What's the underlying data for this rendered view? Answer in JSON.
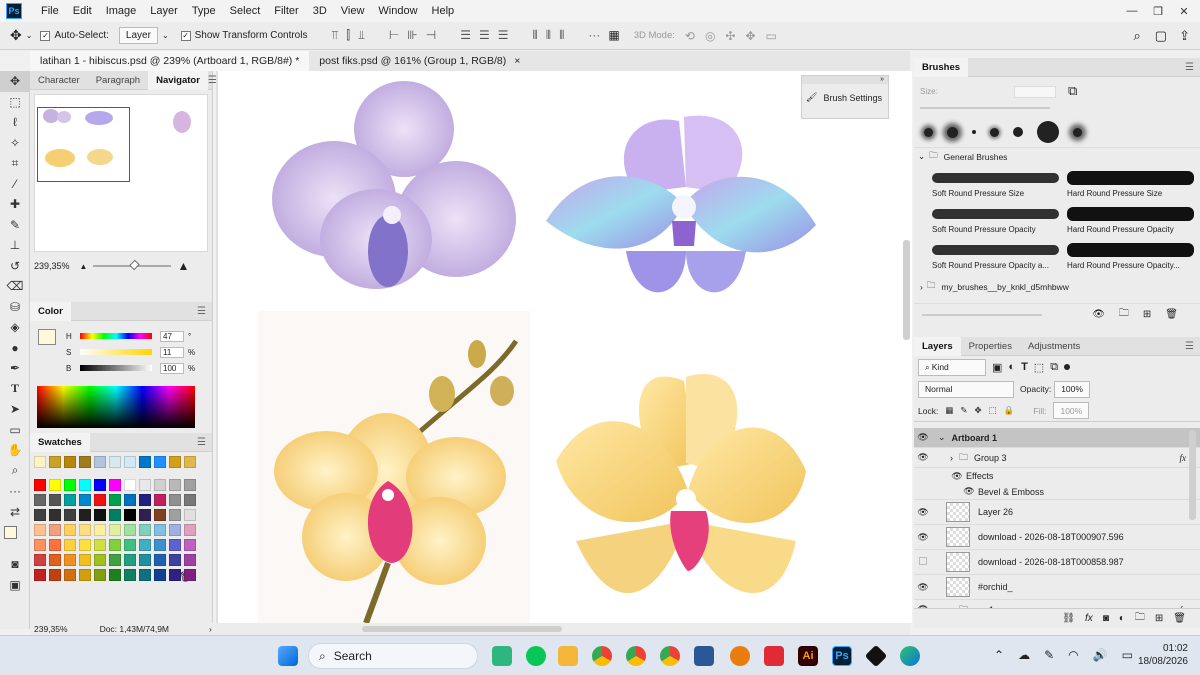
{
  "app": {
    "logo": "Ps"
  },
  "menu": [
    "File",
    "Edit",
    "Image",
    "Layer",
    "Type",
    "Select",
    "Filter",
    "3D",
    "View",
    "Window",
    "Help"
  ],
  "options": {
    "auto_select_label": "Auto-Select:",
    "auto_select_value": "Layer",
    "transform_label": "Show Transform Controls",
    "mode3d_label": "3D Mode:"
  },
  "tabs": [
    {
      "label": "latihan 1 - hibiscus.psd @ 239% (Artboard 1, RGB/8#) *",
      "close": "×"
    },
    {
      "label": "post fiks.psd @ 161% (Group 1, RGB/8)",
      "close": "×"
    }
  ],
  "left_panel": {
    "tabs": [
      "Character",
      "Paragraph",
      "Navigator"
    ],
    "nav_zoom": "239,35%",
    "color_tab": "Color",
    "hsb": [
      {
        "label": "H",
        "value": "47",
        "unit": "°"
      },
      {
        "label": "S",
        "value": "11",
        "unit": "%"
      },
      {
        "label": "B",
        "value": "100",
        "unit": "%"
      }
    ],
    "swatches_tab": "Swatches"
  },
  "canvas": {
    "brush_settings": "Brush Settings"
  },
  "brushes": {
    "title": "Brushes",
    "size_label": "Size:",
    "group_general": "General Brushes",
    "items": [
      "Soft Round Pressure Size",
      "Hard Round Pressure Size",
      "Soft Round Pressure Opacity",
      "Hard Round Pressure Opacity",
      "Soft Round Pressure Opacity a...",
      "Hard Round Pressure Opacity..."
    ],
    "group_custom": "my_brushes__by_knkl_d5mhbww"
  },
  "layers_panel": {
    "tabs": [
      "Layers",
      "Properties",
      "Adjustments"
    ],
    "kind": "Kind",
    "blend": "Normal",
    "opacity_label": "Opacity:",
    "opacity_value": "100%",
    "lock_label": "Lock:",
    "fill_label": "Fill:",
    "fill_value": "100%",
    "layers": [
      {
        "name": "Artboard 1",
        "visible": true,
        "kind": "artboard"
      },
      {
        "name": "Group 3",
        "visible": true,
        "kind": "group",
        "fx": "fx"
      },
      {
        "name": "Effects",
        "visible": true,
        "kind": "effects"
      },
      {
        "name": "Bevel & Emboss",
        "visible": true,
        "kind": "effect"
      },
      {
        "name": "Layer 26",
        "visible": true,
        "kind": "layer"
      },
      {
        "name": "download - 2026-08-18T000907.596",
        "visible": true,
        "kind": "smart"
      },
      {
        "name": "download - 2026-08-18T000858.987",
        "visible": false,
        "kind": "smart"
      },
      {
        "name": "#orchid_",
        "visible": true,
        "kind": "smart"
      },
      {
        "name": "orc 1",
        "visible": true,
        "kind": "group",
        "fx": "fx"
      }
    ]
  },
  "status": {
    "zoom": "239,35%",
    "doc": "Doc: 1,43M/74,9M"
  },
  "taskbar": {
    "search": "Search",
    "time": "01:02",
    "date": "18/08/2026"
  },
  "colors": {
    "accent": "#31a8ff",
    "fg_swatch": "#fff8dc",
    "nav_frame": "#e02020"
  },
  "swatch_colors": [
    "#fff3c4",
    "#c9a227",
    "#b8860b",
    "#9e7d1a",
    "#b0c4de",
    "#d8e8f0",
    "#d0e8f8",
    "#0077cc",
    "#1e90ff",
    "#d4a017",
    "#e0b84a",
    "#ff0000",
    "#ffff00",
    "#00ff00",
    "#00ffff",
    "#0000ff",
    "#ff00ff",
    "#ffffff",
    "#e8e8e8",
    "#d0d0d0",
    "#b8b8b8",
    "#a0a0a0",
    "#666666",
    "#555555",
    "#00a0a0",
    "#0088cc",
    "#ee1111",
    "#00a050",
    "#0070c0",
    "#202080",
    "#c02060",
    "#909090",
    "#787878",
    "#404040",
    "#303030",
    "#404040",
    "#202020",
    "#101010",
    "#008060",
    "#000000",
    "#302050",
    "#804020",
    "#a0a0a0",
    "#e0e0e0",
    "#ffc090",
    "#f0a080",
    "#ffd060",
    "#ffe080",
    "#fff0a0",
    "#e0f0a0",
    "#a0e0a0",
    "#80d0c0",
    "#80c0e0",
    "#a0b0e0",
    "#e0a0c0",
    "#ff9060",
    "#ff7040",
    "#ffd040",
    "#ffe040",
    "#d0e040",
    "#80d040",
    "#40c080",
    "#40b0c0",
    "#4090d0",
    "#6060d0",
    "#c060c0",
    "#d04040",
    "#e06020",
    "#f09020",
    "#f0c020",
    "#a0c020",
    "#40a040",
    "#20a080",
    "#2090a0",
    "#2060b0",
    "#4040a0",
    "#a040a0",
    "#c02020",
    "#c04010",
    "#d07010",
    "#d0a010",
    "#80a010",
    "#208020",
    "#108060",
    "#107080",
    "#104090",
    "#302080",
    "#802080"
  ]
}
